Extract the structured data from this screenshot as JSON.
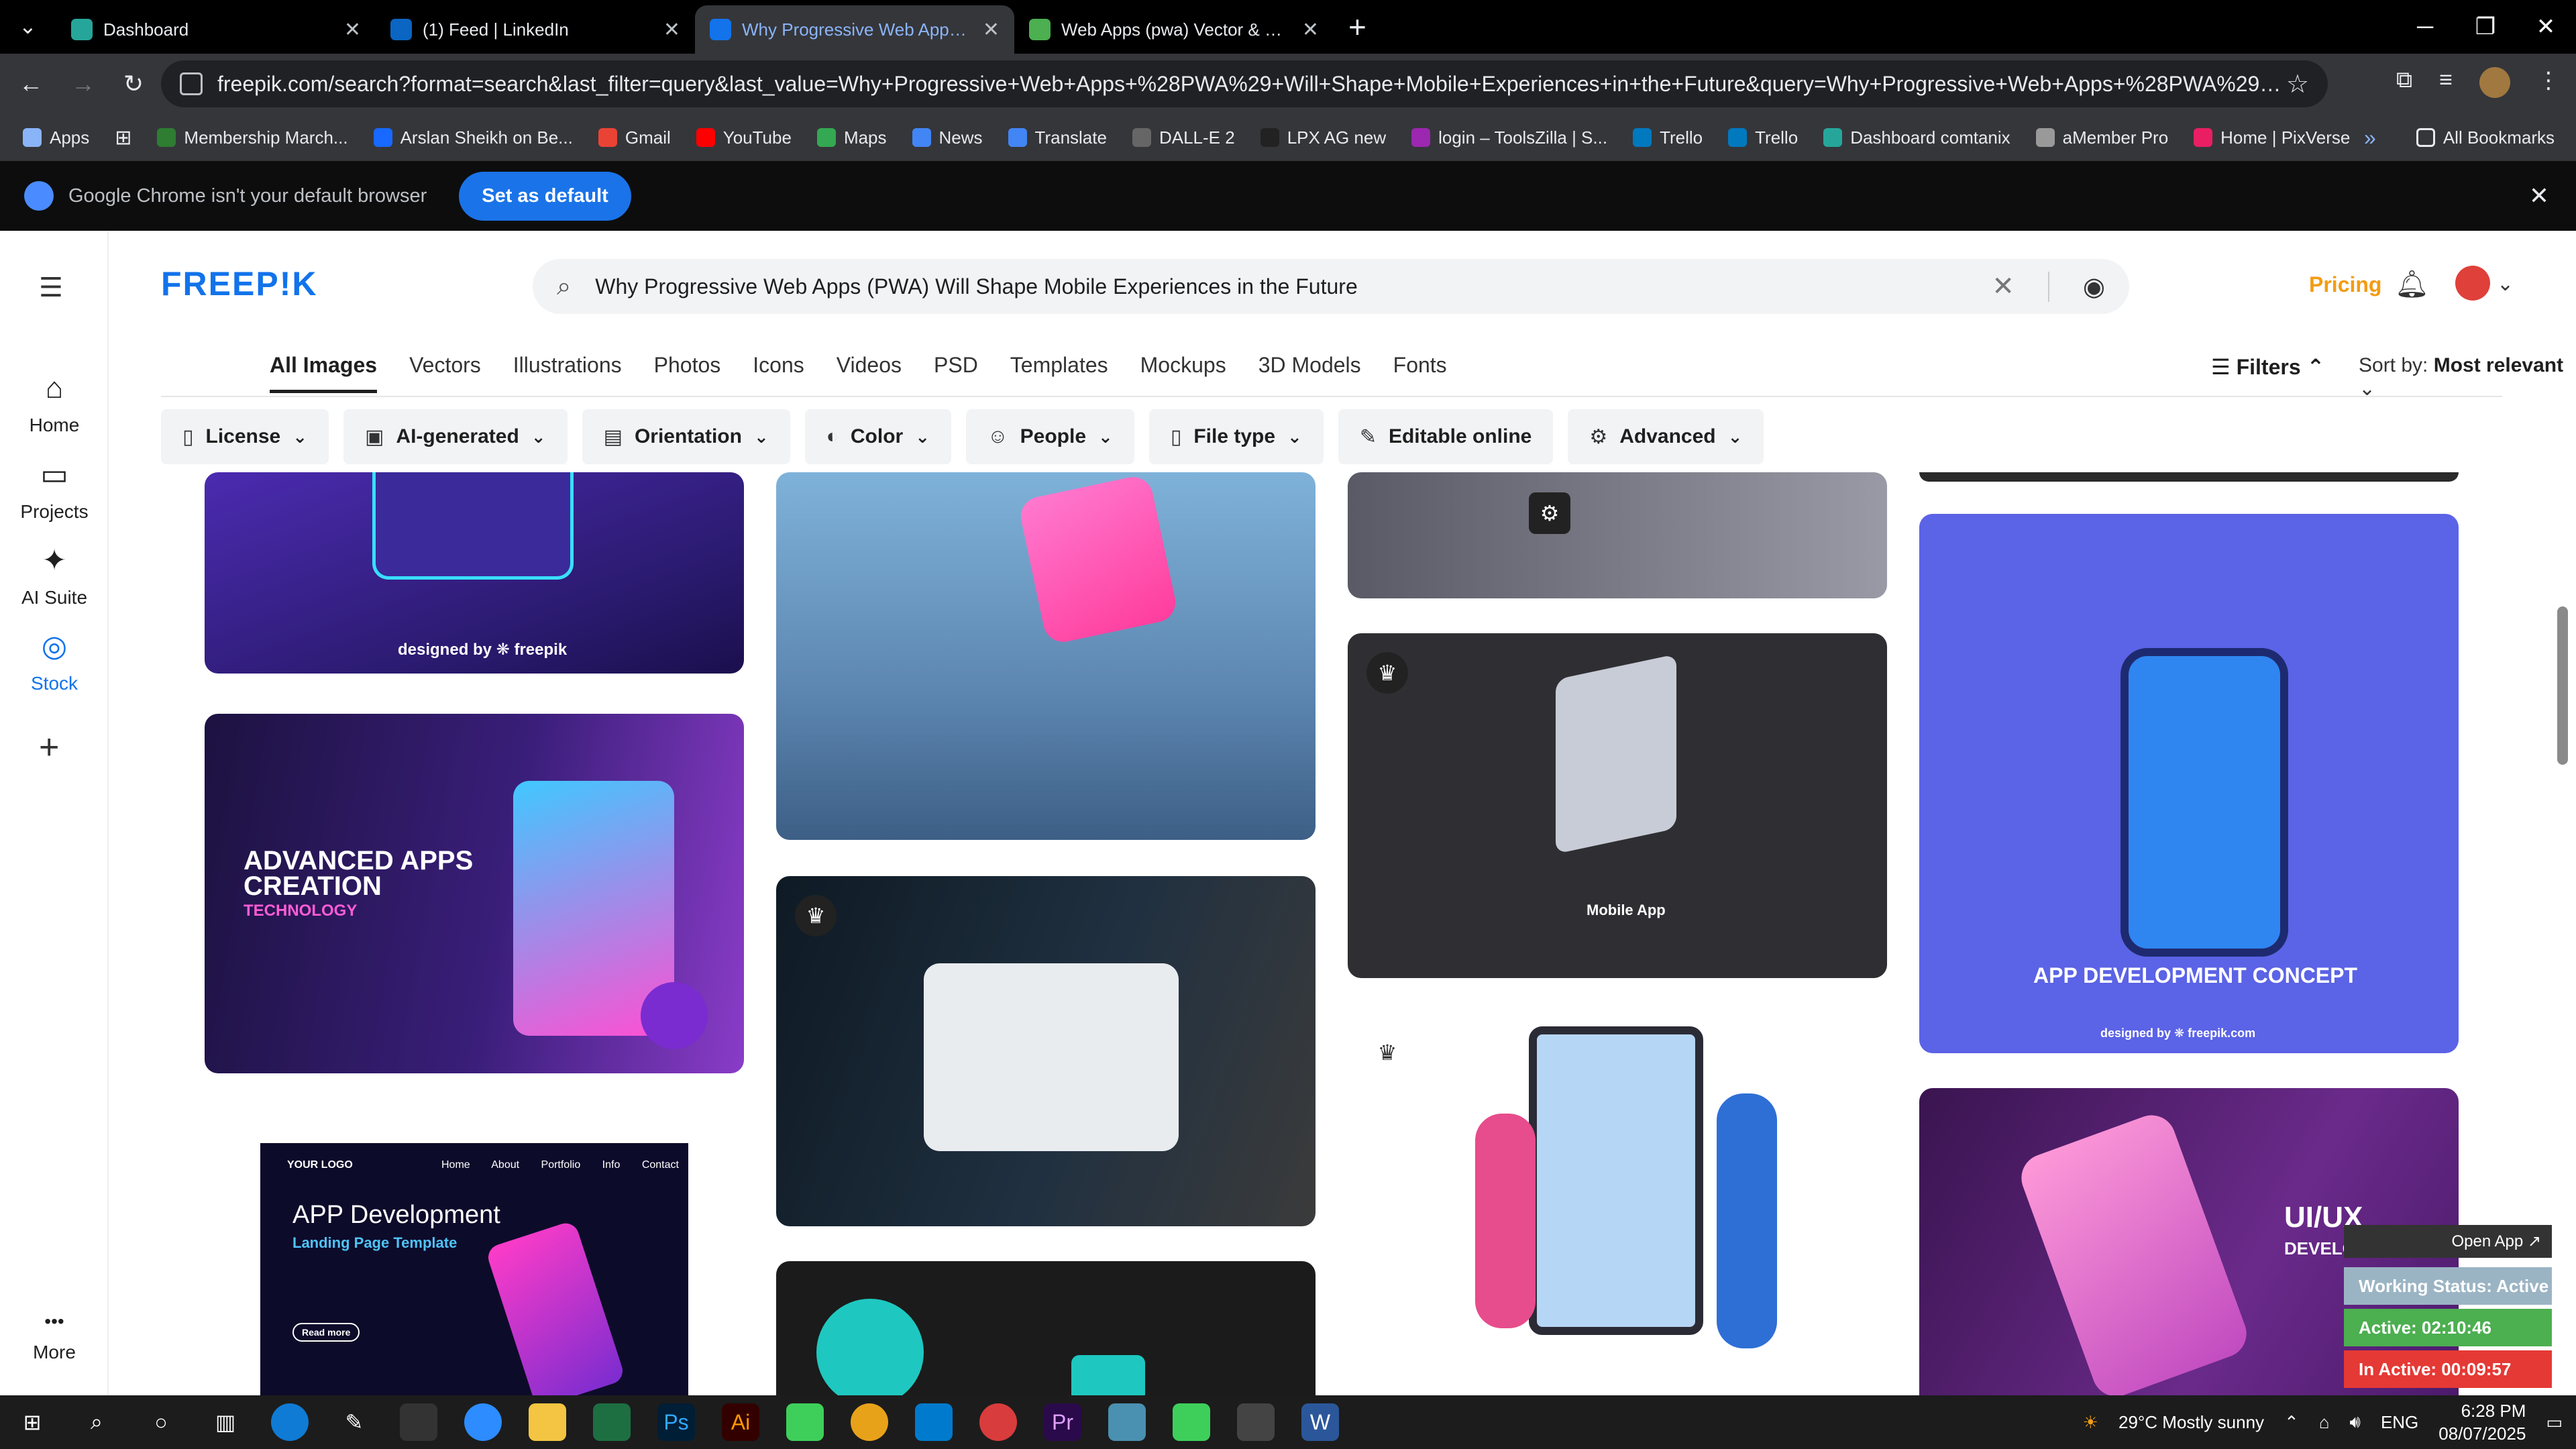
{
  "browser": {
    "tabs": [
      {
        "label": "Dashboard",
        "active": false
      },
      {
        "label": "(1) Feed | LinkedIn",
        "active": false
      },
      {
        "label": "Why Progressive Web Apps (PW",
        "active": true
      },
      {
        "label": "Web Apps (pwa) Vector & Laye",
        "active": false
      }
    ],
    "url": "freepik.com/search?format=search&last_filter=query&last_value=Why+Progressive+Web+Apps+%28PWA%29+Will+Shape+Mobile+Experiences+in+the+Future&query=Why+Progressive+Web+Apps+%28PWA%29+Will+Shape+Mobile+Experien...",
    "bookmarks": [
      "Apps",
      "Membership March...",
      "Arslan Sheikh on Be...",
      "Gmail",
      "YouTube",
      "Maps",
      "News",
      "Translate",
      "DALL-E 2",
      "LPX AG new",
      "login – ToolsZilla | S...",
      "Trello",
      "Trello",
      "Dashboard comtanix",
      "aMember Pro",
      "Home | PixVerse"
    ],
    "all_bookmarks": "All Bookmarks",
    "infobar": {
      "message": "Google Chrome isn't your default browser",
      "button": "Set as default"
    }
  },
  "rail": [
    {
      "label": "Home",
      "icon": "home-icon",
      "glyph": "⌂"
    },
    {
      "label": "Projects",
      "icon": "projects-icon",
      "glyph": "▭"
    },
    {
      "label": "AI Suite",
      "icon": "ai-suite-icon",
      "glyph": "✦"
    },
    {
      "label": "Stock",
      "icon": "stock-icon",
      "glyph": "◎"
    },
    {
      "label": "More",
      "icon": "more-icon",
      "glyph": "•••"
    }
  ],
  "header": {
    "logo": "FREEP!K",
    "search_value": "Why Progressive Web Apps (PWA) Will Shape Mobile Experiences in the Future",
    "pricing": "Pricing"
  },
  "categories": [
    "All Images",
    "Vectors",
    "Illustrations",
    "Photos",
    "Icons",
    "Videos",
    "PSD",
    "Templates",
    "Mockups",
    "3D Models",
    "Fonts"
  ],
  "filters_label": "Filters",
  "sort": {
    "label": "Sort by:",
    "value": "Most relevant"
  },
  "filter_chips": [
    "License",
    "AI-generated",
    "Orientation",
    "Color",
    "People",
    "File type",
    "Editable online",
    "Advanced"
  ],
  "cards": {
    "c1": "designed by ❋ freepik",
    "c2_title": "ADVANCED APPS CREATION",
    "c2_sub": "TECHNOLOGY",
    "c3_title": "APP Development",
    "c3_sub": "Landing Page Template",
    "c3_logo": "YOUR LOGO",
    "c3_nav": [
      "Home",
      "About",
      "Portfolio",
      "Info",
      "Contact"
    ],
    "c3_btn": "Read more",
    "c4_label": "Mobile App",
    "c5_title": "APP DEVELOPMENT CONCEPT",
    "c5_credit": "designed by ❋ freepik.com",
    "c6_title": "UI/UX",
    "c6_sub": "DEVELOPMENT"
  },
  "widget": {
    "open_app": "Open App ↗",
    "status": "Working Status: Active",
    "active": "Active: 02:10:46",
    "inactive": "In Active: 00:09:57"
  },
  "taskbar": {
    "weather": "29°C  Mostly sunny",
    "lang": "ENG",
    "time": "6:28 PM",
    "date": "08/07/2025"
  },
  "colors": {
    "accent": "#1273eb",
    "pricing": "#f39c12",
    "widget_active": "#4caf50",
    "widget_inactive": "#e53935"
  }
}
